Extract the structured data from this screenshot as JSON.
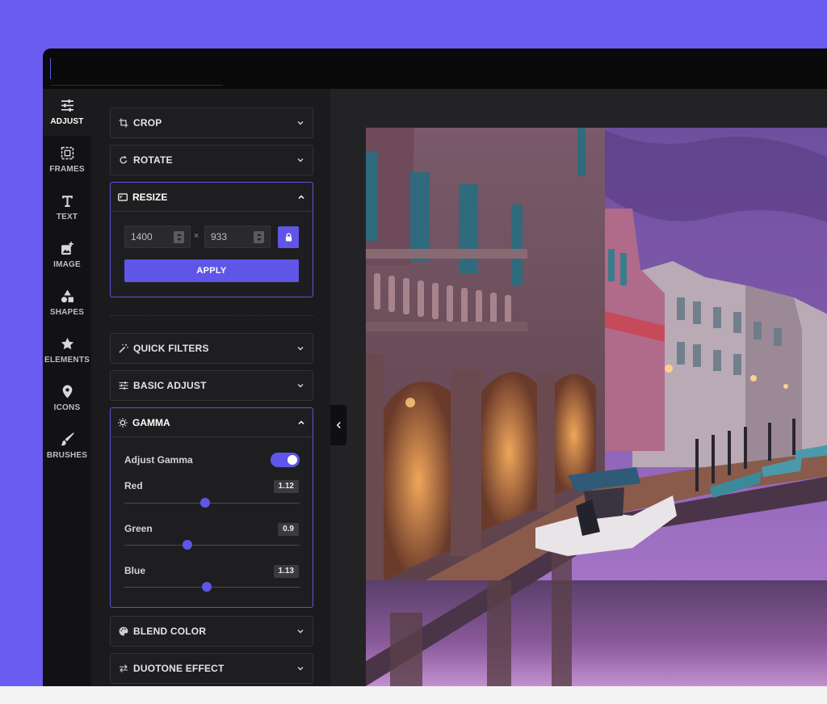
{
  "nav": {
    "items": [
      {
        "label": "ADJUST",
        "icon": "sliders-icon",
        "active": true
      },
      {
        "label": "FRAMES",
        "icon": "frame-icon",
        "active": false
      },
      {
        "label": "TEXT",
        "icon": "text-icon",
        "active": false
      },
      {
        "label": "IMAGE",
        "icon": "add-image-icon",
        "active": false
      },
      {
        "label": "SHAPES",
        "icon": "shapes-icon",
        "active": false
      },
      {
        "label": "ELEMENTS",
        "icon": "star-icon",
        "active": false
      },
      {
        "label": "ICONS",
        "icon": "map-pin-icon",
        "active": false
      },
      {
        "label": "BRUSHES",
        "icon": "brush-icon",
        "active": false
      }
    ]
  },
  "panel": {
    "crop": {
      "title": "CROP",
      "icon": "crop-icon"
    },
    "rotate": {
      "title": "ROTATE",
      "icon": "rotate-icon"
    },
    "resize": {
      "title": "RESIZE",
      "icon": "resize-icon",
      "width": "1400",
      "height": "933",
      "separator": "×",
      "apply_label": "APPLY"
    },
    "quick_filters": {
      "title": "QUICK FILTERS",
      "icon": "magic-wand-icon"
    },
    "basic_adjust": {
      "title": "BASIC ADJUST",
      "icon": "tune-icon"
    },
    "gamma": {
      "title": "GAMMA",
      "icon": "sun-icon",
      "toggle_label": "Adjust Gamma",
      "toggle_on": true,
      "sliders": [
        {
          "label": "Red",
          "value": "1.12",
          "fraction": 0.46
        },
        {
          "label": "Green",
          "value": "0.9",
          "fraction": 0.36
        },
        {
          "label": "Blue",
          "value": "1.13",
          "fraction": 0.47
        }
      ]
    },
    "blend_color": {
      "title": "BLEND COLOR",
      "icon": "palette-icon"
    },
    "duotone": {
      "title": "DUOTONE EFFECT",
      "icon": "swap-icon"
    }
  },
  "colors": {
    "accent": "#5f56e8",
    "page_background": "#6b5cf0",
    "panel_background": "#1b1b1d"
  }
}
